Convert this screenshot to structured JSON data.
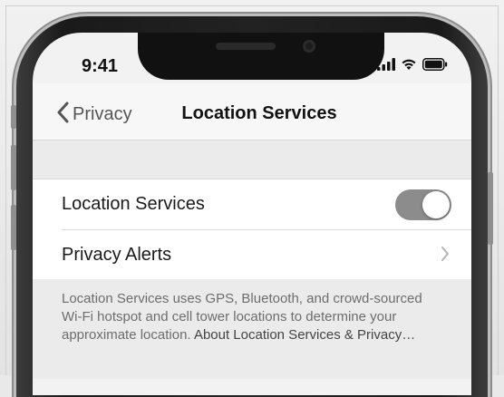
{
  "status_bar": {
    "time": "9:41",
    "icons": [
      "signal-icon",
      "wifi-icon",
      "battery-icon"
    ]
  },
  "nav": {
    "back_label": "Privacy",
    "title": "Location Services"
  },
  "settings": {
    "rows": [
      {
        "label": "Location Services",
        "control": "toggle",
        "enabled": true
      },
      {
        "label": "Privacy Alerts",
        "control": "chevron"
      }
    ]
  },
  "footer": {
    "description": "Location Services uses GPS, Bluetooth, and crowd-sourced Wi-Fi hotspot and cell tower locations to determine your approximate location.",
    "link_text": "About Location Services & Privacy…"
  },
  "colors": {
    "toggle_on": "#8c8c8c",
    "screen_bg": "#f2f2f2",
    "phone_frame": "#1f1f1f"
  }
}
